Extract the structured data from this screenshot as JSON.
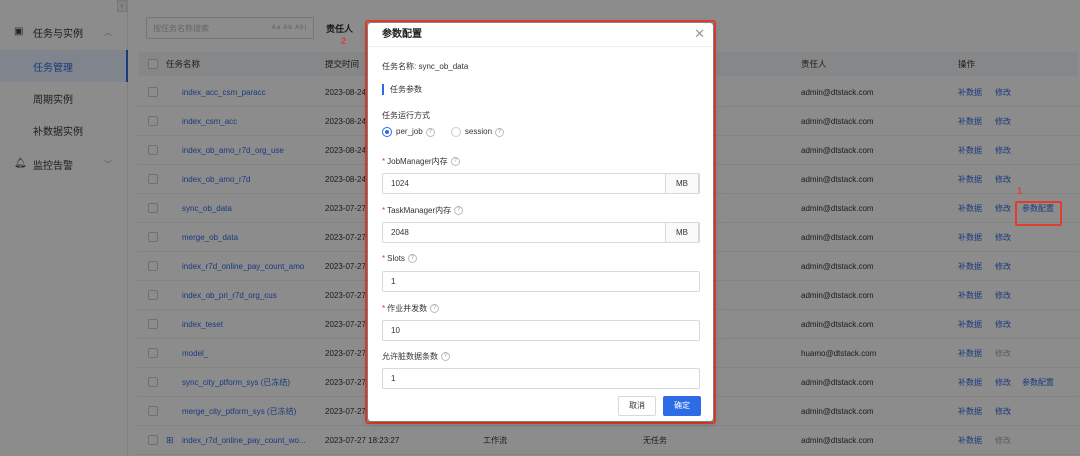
{
  "sidebar": {
    "collapse_glyph": "‹",
    "groups": [
      {
        "label": "任务与实例",
        "icon": "task-icon",
        "expanded": true
      },
      {
        "label": "监控告警",
        "icon": "bell-icon",
        "expanded": false
      }
    ],
    "items": [
      {
        "label": "任务管理",
        "active": true
      },
      {
        "label": "周期实例",
        "active": false
      },
      {
        "label": "补数据实例",
        "active": false
      }
    ]
  },
  "toolbar": {
    "search_placeholder": "按任务名称搜索",
    "search_opts": "Aa  Ab  Ab|",
    "filter_label": "责任人"
  },
  "table": {
    "headers": {
      "name": "任务名称",
      "submit_time": "提交时间",
      "owner": "责任人",
      "actions": "操作"
    },
    "rows": [
      {
        "name": "index_acc_csm_paracc",
        "time": "2023-08-24",
        "type": "",
        "sub": "",
        "owner": "admin@dtstack.com",
        "actions": [
          "补数据",
          "修改"
        ]
      },
      {
        "name": "index_csm_acc",
        "time": "2023-08-24",
        "type": "",
        "sub": "",
        "owner": "admin@dtstack.com",
        "actions": [
          "补数据",
          "修改"
        ]
      },
      {
        "name": "index_ob_amo_r7d_org_use",
        "time": "2023-08-24",
        "type": "",
        "sub": "",
        "owner": "admin@dtstack.com",
        "actions": [
          "补数据",
          "修改"
        ]
      },
      {
        "name": "index_ob_amo_r7d",
        "time": "2023-08-24",
        "type": "",
        "sub": "",
        "owner": "admin@dtstack.com",
        "actions": [
          "补数据",
          "修改"
        ]
      },
      {
        "name": "sync_ob_data",
        "time": "2023-07-27",
        "type": "",
        "sub": "",
        "owner": "admin@dtstack.com",
        "actions": [
          "补数据",
          "修改",
          "参数配置"
        ]
      },
      {
        "name": "merge_ob_data",
        "time": "2023-07-27",
        "type": "",
        "sub": "",
        "owner": "admin@dtstack.com",
        "actions": [
          "补数据",
          "修改"
        ]
      },
      {
        "name": "index_r7d_online_pay_count_amo",
        "time": "2023-07-27",
        "type": "",
        "sub": "",
        "owner": "admin@dtstack.com",
        "actions": [
          "补数据",
          "修改"
        ]
      },
      {
        "name": "index_ob_pri_r7d_org_cus",
        "time": "2023-07-27",
        "type": "",
        "sub": "",
        "owner": "admin@dtstack.com",
        "actions": [
          "补数据",
          "修改"
        ]
      },
      {
        "name": "index_teset",
        "time": "2023-07-27",
        "type": "",
        "sub": "",
        "owner": "admin@dtstack.com",
        "actions": [
          "补数据",
          "修改"
        ]
      },
      {
        "name": "model_",
        "time": "2023-07-27",
        "type": "",
        "sub": "",
        "owner": "huamo@dtstack.com",
        "actions": [
          "补数据",
          "修改"
        ]
      },
      {
        "name": "sync_city_ptform_sys (已冻结)",
        "time": "2023-07-27",
        "type": "",
        "sub": "",
        "owner": "admin@dtstack.com",
        "actions": [
          "补数据",
          "修改",
          "参数配置"
        ]
      },
      {
        "name": "merge_city_ptform_sys (已冻结)",
        "time": "2023-07-27",
        "type": "",
        "sub": "",
        "owner": "admin@dtstack.com",
        "actions": [
          "补数据",
          "修改"
        ]
      },
      {
        "name": "index_r7d_online_pay_count_wo...",
        "time": "2023-07-27 18:23:27",
        "type": "工作流",
        "sub": "无任务",
        "owner": "admin@dtstack.com",
        "actions": [
          "补数据",
          "修改"
        ]
      }
    ]
  },
  "modal": {
    "title": "参数配置",
    "close_glyph": "✕",
    "task_name_label": "任务名称:",
    "task_name_value": "sync_ob_data",
    "section_title": "任务参数",
    "run_mode_label": "任务运行方式",
    "run_modes": [
      {
        "label": "per_job",
        "selected": true
      },
      {
        "label": "session",
        "selected": false
      }
    ],
    "fields": [
      {
        "label": "JobManager内存",
        "required": true,
        "value": "1024",
        "suffix": "MB"
      },
      {
        "label": "TaskManager内存",
        "required": true,
        "value": "2048",
        "suffix": "MB"
      },
      {
        "label": "Slots",
        "required": true,
        "value": "1",
        "suffix": ""
      },
      {
        "label": "作业并发数",
        "required": true,
        "value": "10",
        "suffix": ""
      },
      {
        "label": "允许脏数据条数",
        "required": false,
        "value": "1",
        "suffix": ""
      }
    ],
    "cancel_label": "取消",
    "ok_label": "确定"
  },
  "annotations": {
    "step1": "1",
    "step2": "2"
  }
}
